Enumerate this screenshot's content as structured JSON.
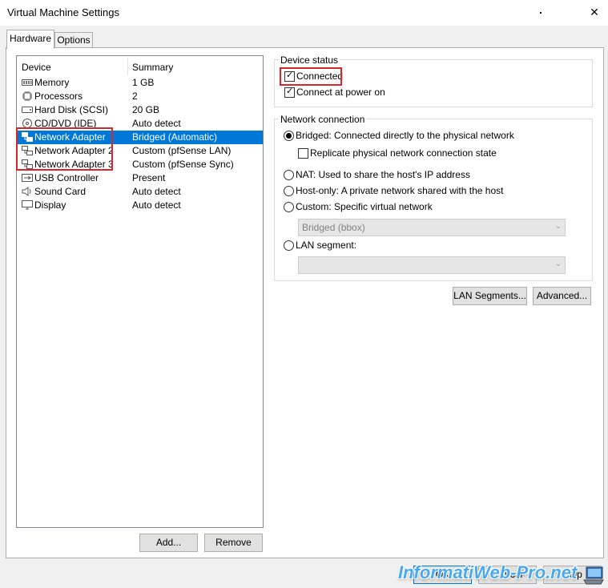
{
  "window": {
    "title": "Virtual Machine Settings",
    "close_glyph": "✕"
  },
  "tabs": [
    {
      "label": "Hardware",
      "active": true
    },
    {
      "label": "Options",
      "active": false
    }
  ],
  "device_list": {
    "col_device": "Device",
    "col_summary": "Summary",
    "rows": [
      {
        "name": "Memory",
        "summary": "1 GB",
        "icon": "memory-icon"
      },
      {
        "name": "Processors",
        "summary": "2",
        "icon": "processor-icon"
      },
      {
        "name": "Hard Disk (SCSI)",
        "summary": "20 GB",
        "icon": "hard-disk-icon"
      },
      {
        "name": "CD/DVD (IDE)",
        "summary": "Auto detect",
        "icon": "cd-dvd-icon"
      },
      {
        "name": "Network Adapter",
        "summary": "Bridged (Automatic)",
        "icon": "network-adapter-icon",
        "selected": true
      },
      {
        "name": "Network Adapter 2",
        "summary": "Custom (pfSense LAN)",
        "icon": "network-adapter-icon"
      },
      {
        "name": "Network Adapter 3",
        "summary": "Custom (pfSense Sync)",
        "icon": "network-adapter-icon"
      },
      {
        "name": "USB Controller",
        "summary": "Present",
        "icon": "usb-icon"
      },
      {
        "name": "Sound Card",
        "summary": "Auto detect",
        "icon": "speaker-icon"
      },
      {
        "name": "Display",
        "summary": "Auto detect",
        "icon": "display-icon"
      }
    ]
  },
  "buttons": {
    "add": "Add...",
    "remove": "Remove",
    "lan_segments": "LAN Segments...",
    "advanced": "Advanced...",
    "ok": "OK",
    "cancel": "Cancel",
    "help": "Help"
  },
  "device_status": {
    "title": "Device status",
    "connected": {
      "label": "Connected",
      "checked": true
    },
    "connect_at_power_on": {
      "label": "Connect at power on",
      "checked": true
    }
  },
  "network_connection": {
    "title": "Network connection",
    "bridged": {
      "label": "Bridged: Connected directly to the physical network",
      "selected": true
    },
    "replicate": {
      "label": "Replicate physical network connection state",
      "checked": false
    },
    "nat": {
      "label": "NAT: Used to share the host's IP address"
    },
    "host_only": {
      "label": "Host-only: A private network shared with the host"
    },
    "custom": {
      "label": "Custom: Specific virtual network"
    },
    "custom_select": {
      "value": "Bridged (bbox)"
    },
    "lan_segment": {
      "label": "LAN segment:"
    },
    "lan_segment_select": {
      "value": ""
    }
  },
  "watermark": {
    "text": "InformatiWeb-Pro.net"
  },
  "colors": {
    "selection": "#0078d7",
    "highlight_box": "#d9262c",
    "watermark": "#4aa8ee"
  }
}
